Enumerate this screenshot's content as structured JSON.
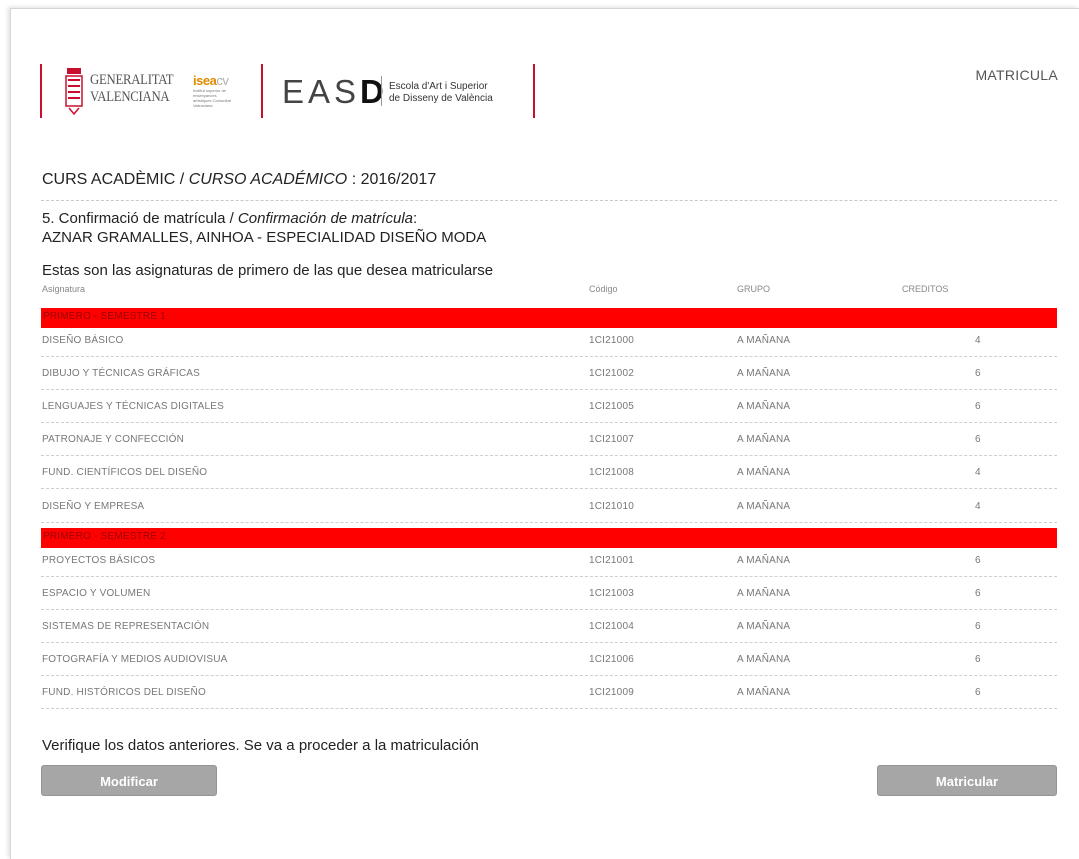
{
  "header": {
    "gv_line1": "GENERALITAT",
    "gv_line2": "VALENCIANA",
    "isea_brand": "isea",
    "isea_brand_cv": "cv",
    "isea_sub": "Institut superior de ensenyances artístiques Comunitat Valenciana",
    "easd_light": "EAS",
    "easd_bold": "D",
    "easd_line1": "Escola d'Art i Superior",
    "easd_line2": "de Disseny de València",
    "top_right": "MATRICULA",
    "accent_color": "#c8102e"
  },
  "course": {
    "label_va": "CURS ACADÈMIC /",
    "label_es": "CURSO ACADÉMICO",
    "value": ": 2016/2017"
  },
  "step": {
    "title_va": "5. Confirmació de matrícula /",
    "title_es": "Confirmación de matrícula",
    "title_end": ":",
    "student": "AZNAR GRAMALLES, AINHOA - ESPECIALIDAD DISEÑO MODA"
  },
  "intro": "Estas son las asignaturas de primero de las que desea matricularse",
  "columns": {
    "subject": "Asignatura",
    "code": "Código",
    "group": "GRUPO",
    "credits": "CREDITOS"
  },
  "semesters": [
    {
      "label": "PRIMERO - SEMESTRE 1",
      "rows": [
        {
          "name": "DISEÑO BÁSICO",
          "code": "1CI21000",
          "group": "A MAÑANA",
          "credits": "4"
        },
        {
          "name": "DIBUJO Y TÉCNICAS GRÁFICAS",
          "code": "1CI21002",
          "group": "A MAÑANA",
          "credits": "6"
        },
        {
          "name": "LENGUAJES Y TÉCNICAS DIGITALES",
          "code": "1CI21005",
          "group": "A MAÑANA",
          "credits": "6"
        },
        {
          "name": "PATRONAJE Y CONFECCIÓN",
          "code": "1CI21007",
          "group": "A MAÑANA",
          "credits": "6"
        },
        {
          "name": "FUND. CIENTÍFICOS DEL DISEÑO",
          "code": "1CI21008",
          "group": "A MAÑANA",
          "credits": "4"
        },
        {
          "name": "DISEÑO Y EMPRESA",
          "code": "1CI21010",
          "group": "A MAÑANA",
          "credits": "4"
        }
      ]
    },
    {
      "label": "PRIMERO - SEMESTRE 2",
      "rows": [
        {
          "name": "PROYECTOS BÁSICOS",
          "code": "1CI21001",
          "group": "A MAÑANA",
          "credits": "6"
        },
        {
          "name": "ESPACIO Y VOLUMEN",
          "code": "1CI21003",
          "group": "A MAÑANA",
          "credits": "6"
        },
        {
          "name": "SISTEMAS DE REPRESENTACIÓN",
          "code": "1CI21004",
          "group": "A MAÑANA",
          "credits": "6"
        },
        {
          "name": "FOTOGRAFÍA Y MEDIOS AUDIOVISUA",
          "code": "1CI21006",
          "group": "A MAÑANA",
          "credits": "6"
        },
        {
          "name": "FUND. HISTÓRICOS DEL DISEÑO",
          "code": "1CI21009",
          "group": "A MAÑANA",
          "credits": "6"
        }
      ]
    }
  ],
  "verify_text": "Verifique los datos anteriores. Se va a proceder a la matriculación",
  "buttons": {
    "modify": "Modificar",
    "enroll": "Matricular"
  },
  "colors": {
    "semester_bar": "#ff0000",
    "button_bg": "#a6a6a6"
  }
}
